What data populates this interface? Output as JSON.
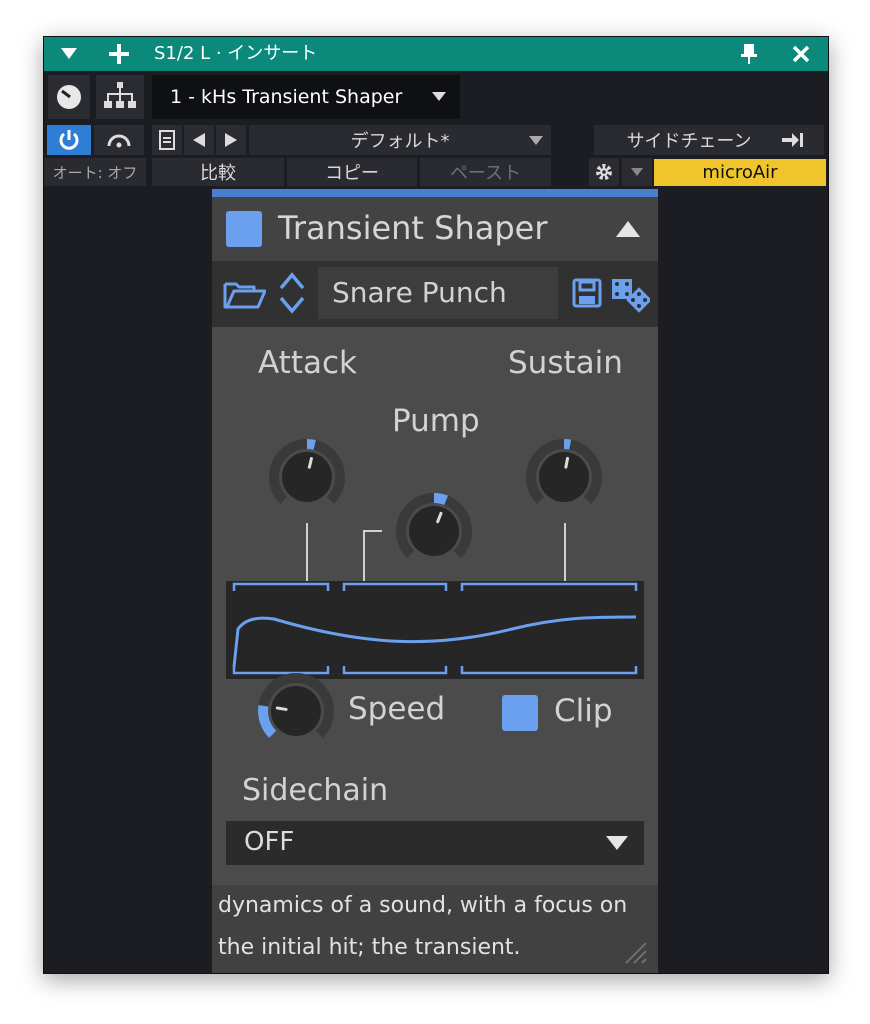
{
  "window": {
    "title": "S1/2 L · インサート",
    "titlebar_color": "#0b8a7c"
  },
  "toolbar": {
    "plugin_name": "1 - kHs Transient Shaper",
    "preset": "デフォルト*",
    "sidechain": "サイドチェーン",
    "auto": "オート: オフ",
    "compare": "比較",
    "copy": "コピー",
    "paste": "ペースト",
    "device": "microAir",
    "device_color": "#f0c42b"
  },
  "plugin": {
    "title": "Transient Shaper",
    "accent_color": "#6aa0ee",
    "preset_name": "Snare Punch",
    "knobs": {
      "attack": {
        "label": "Attack",
        "value": 0.55
      },
      "pump": {
        "label": "Pump",
        "value": 0.58
      },
      "sustain": {
        "label": "Sustain",
        "value": 0.54
      },
      "speed": {
        "label": "Speed",
        "value": 0.2
      }
    },
    "clip": {
      "label": "Clip",
      "checked": true
    },
    "sidechain": {
      "label": "Sidechain",
      "value": "OFF"
    },
    "info_lines": [
      "dynamics of a sound, with a focus on",
      "the initial hit; the transient."
    ]
  }
}
